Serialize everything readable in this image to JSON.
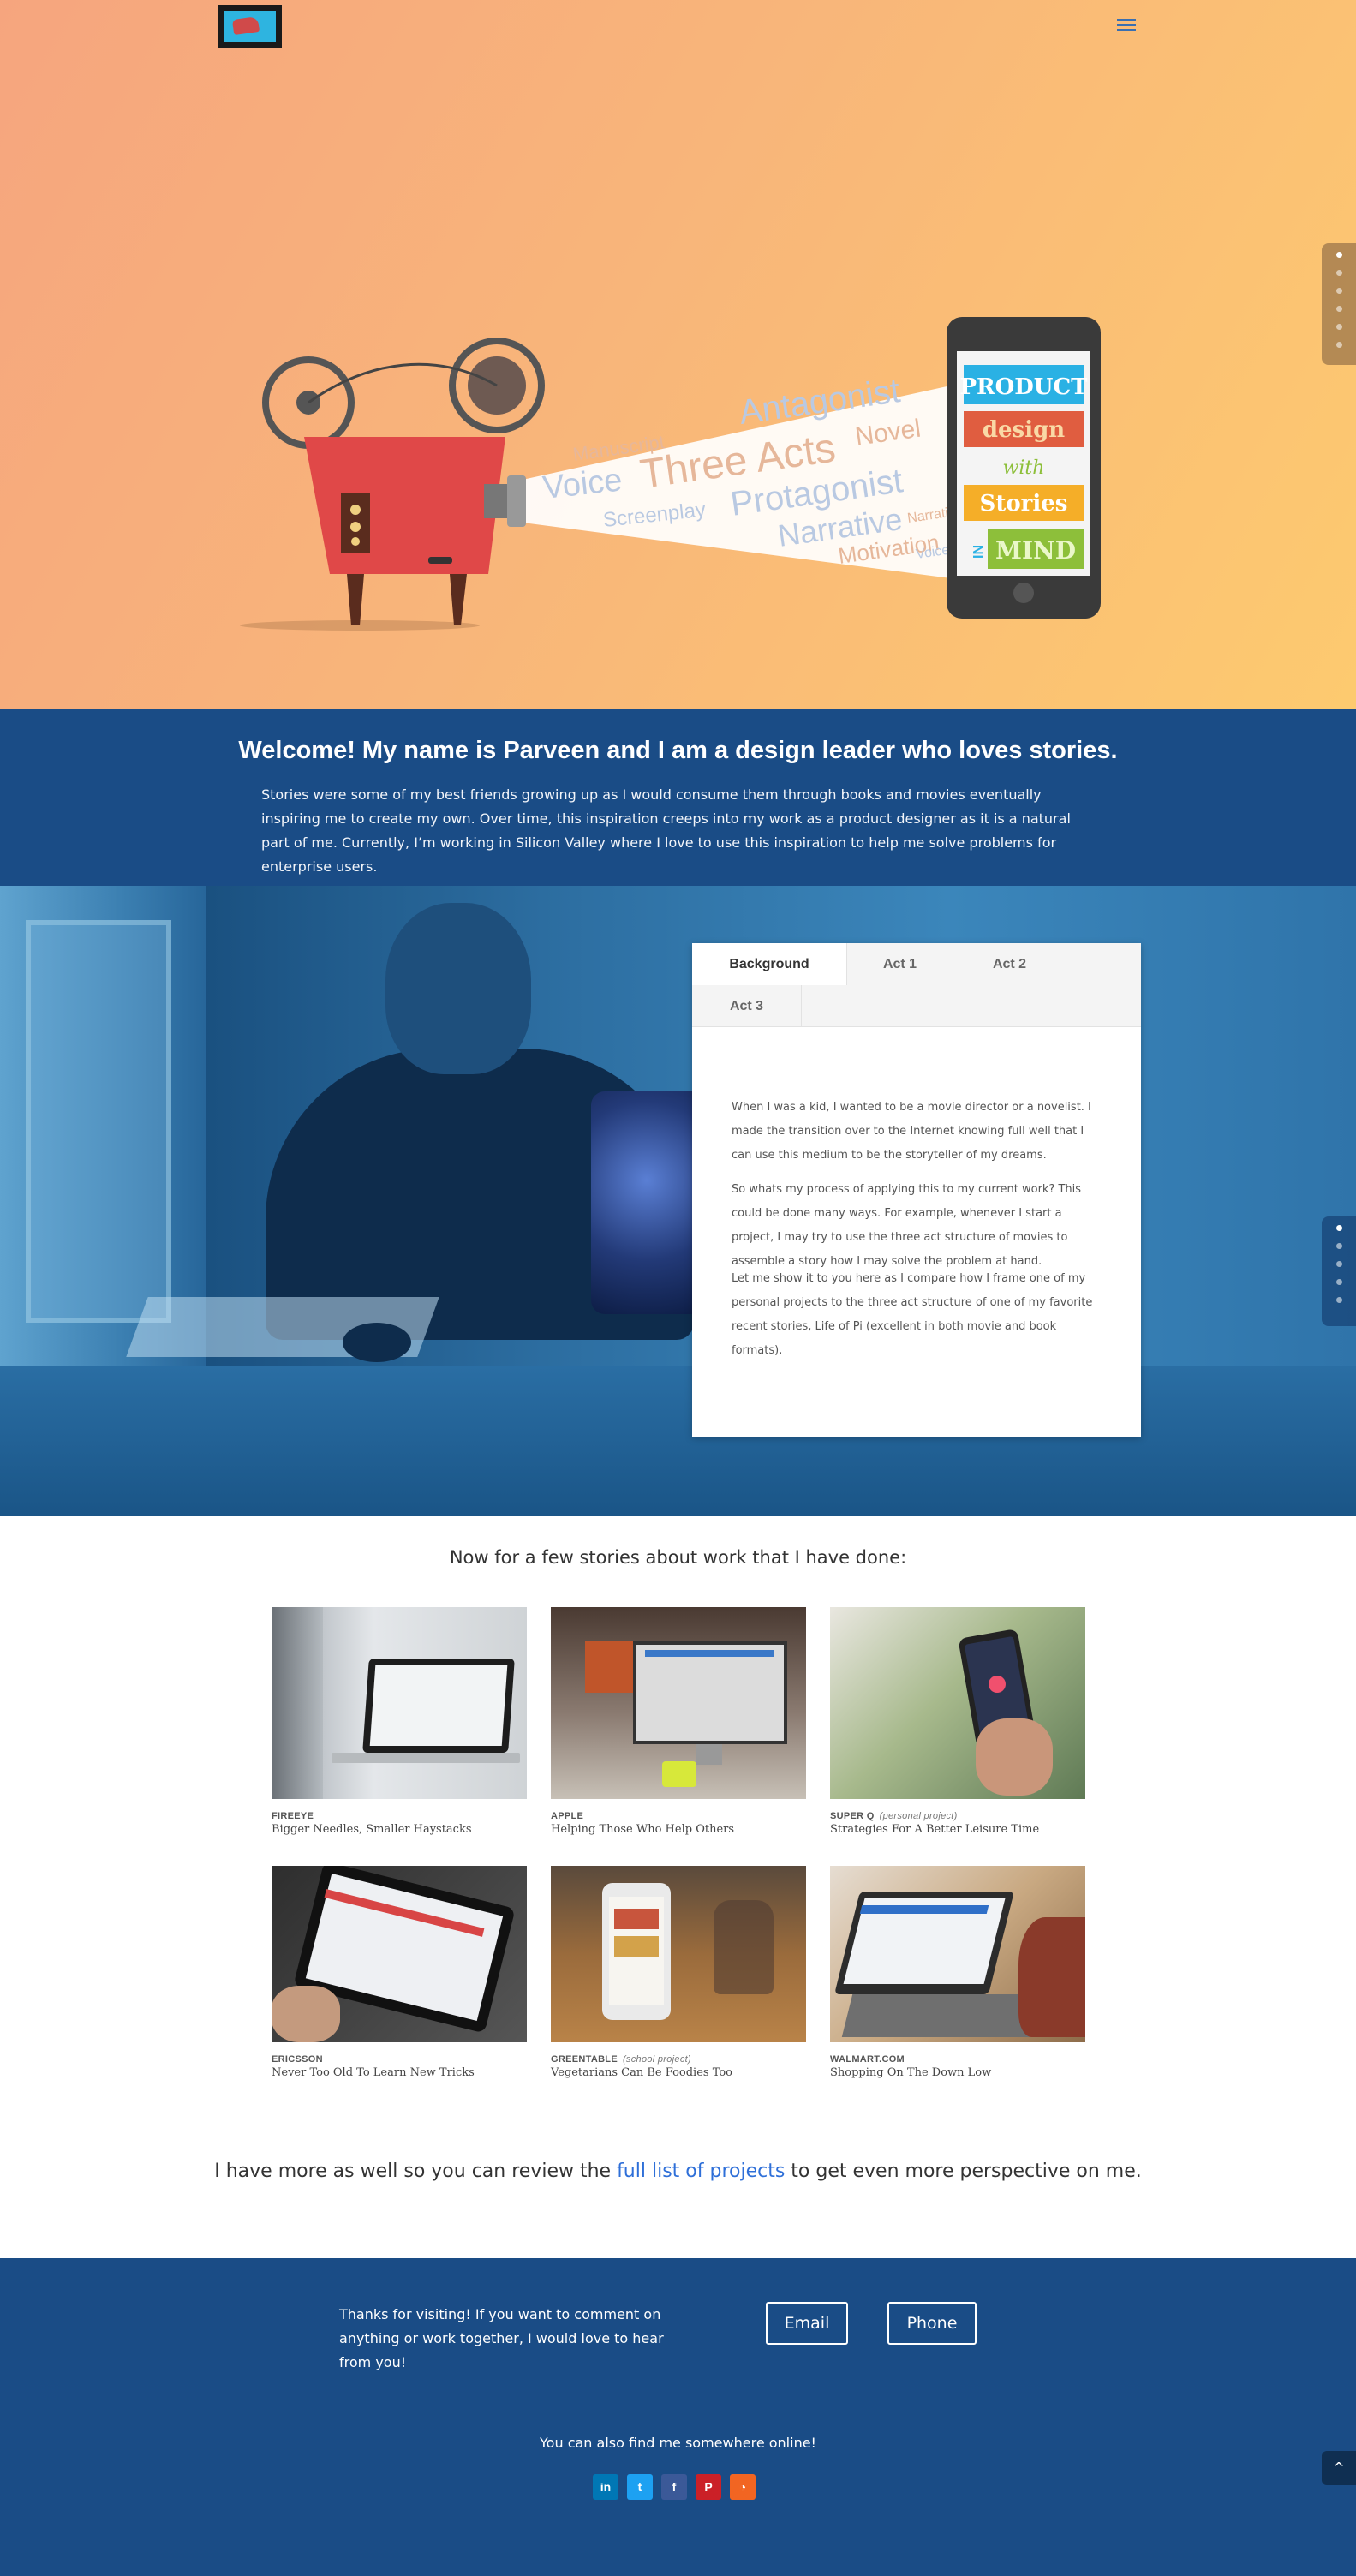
{
  "hero": {
    "phone_lines": [
      "PRODUCT",
      "design",
      "with",
      "Stories",
      "IN",
      "MIND"
    ],
    "beam_words": [
      "Antagonist",
      "Three Acts",
      "Voice",
      "Novel",
      "Manuscript",
      "Protagonist",
      "Screenplay",
      "Narrative",
      "Motivation",
      "Voice",
      "Narrative"
    ],
    "colors": {
      "gradient_start": "#f6a57e",
      "gradient_end": "#fdca6f",
      "projector": "#e04848"
    }
  },
  "nav": {
    "menu_icon": "hamburger-icon",
    "logo_icon": "car-screen-logo"
  },
  "welcome": {
    "heading": "Welcome!  My name is Parveen and I am a design leader who loves stories.",
    "body": "Stories were some of my best friends growing up as I would consume them through books and movies eventually inspiring me to create my own. Over time, this inspiration creeps into my work as a product designer as it is a natural part of me. Currently, I’m working in Silicon Valley where I love to use this inspiration to help me solve problems for enterprise users."
  },
  "tabs": {
    "items": [
      {
        "label": "Background"
      },
      {
        "label": "Act 1"
      },
      {
        "label": "Act 2"
      },
      {
        "label": "Act 3"
      }
    ],
    "content": [
      "When I was a kid, I wanted to be a movie director or a novelist. I made the transition over to the Internet knowing full well that I can use this medium to be the storyteller of my dreams.",
      "So whats my process of applying this to my current work? This could be done many ways.  For example, whenever I start a project, I may try to use the three act structure of movies to assemble a story how I may solve the problem at hand.",
      "Let me show it to you here as I compare how I frame one of my personal projects to the three act structure of one of my favorite recent stories, Life of Pi (excellent in both movie and book formats)."
    ]
  },
  "stories": {
    "heading": "Now for a few stories about work that I have done:",
    "cards": [
      {
        "company": "FIREEYE",
        "note": "",
        "title": "Bigger Needles, Smaller Haystacks"
      },
      {
        "company": "APPLE",
        "note": "",
        "title": "Helping Those Who Help Others"
      },
      {
        "company": "SUPER Q",
        "note": "(personal project)",
        "title": "Strategies For A Better Leisure Time"
      },
      {
        "company": "ERICSSON",
        "note": "",
        "title": "Never Too Old To Learn New Tricks"
      },
      {
        "company": "GREENTABLE",
        "note": "(school project)",
        "title": "Vegetarians Can Be Foodies Too"
      },
      {
        "company": "WALMART.COM",
        "note": "",
        "title": "Shopping On The Down Low"
      }
    ]
  },
  "more": {
    "before": "I have more as well so you can review the ",
    "link": "full list of projects",
    "after": " to get even more perspective on me."
  },
  "footer": {
    "thanks": "Thanks for visiting!  If you want to comment on anything or work together, I would love to hear from you!",
    "email_label": "Email",
    "phone_label": "Phone",
    "find_text": "You can also find me somewhere online!",
    "social": [
      {
        "icon": "linkedin-icon",
        "glyph": "in",
        "color": "#0077b5"
      },
      {
        "icon": "twitter-icon",
        "glyph": "t",
        "color": "#1da1f2"
      },
      {
        "icon": "facebook-icon",
        "glyph": "f",
        "color": "#3b5998"
      },
      {
        "icon": "pinterest-icon",
        "glyph": "P",
        "color": "#cb2027"
      },
      {
        "icon": "rss-icon",
        "glyph": "◔",
        "color": "#f26522"
      }
    ],
    "to_top_glyph": "^"
  }
}
